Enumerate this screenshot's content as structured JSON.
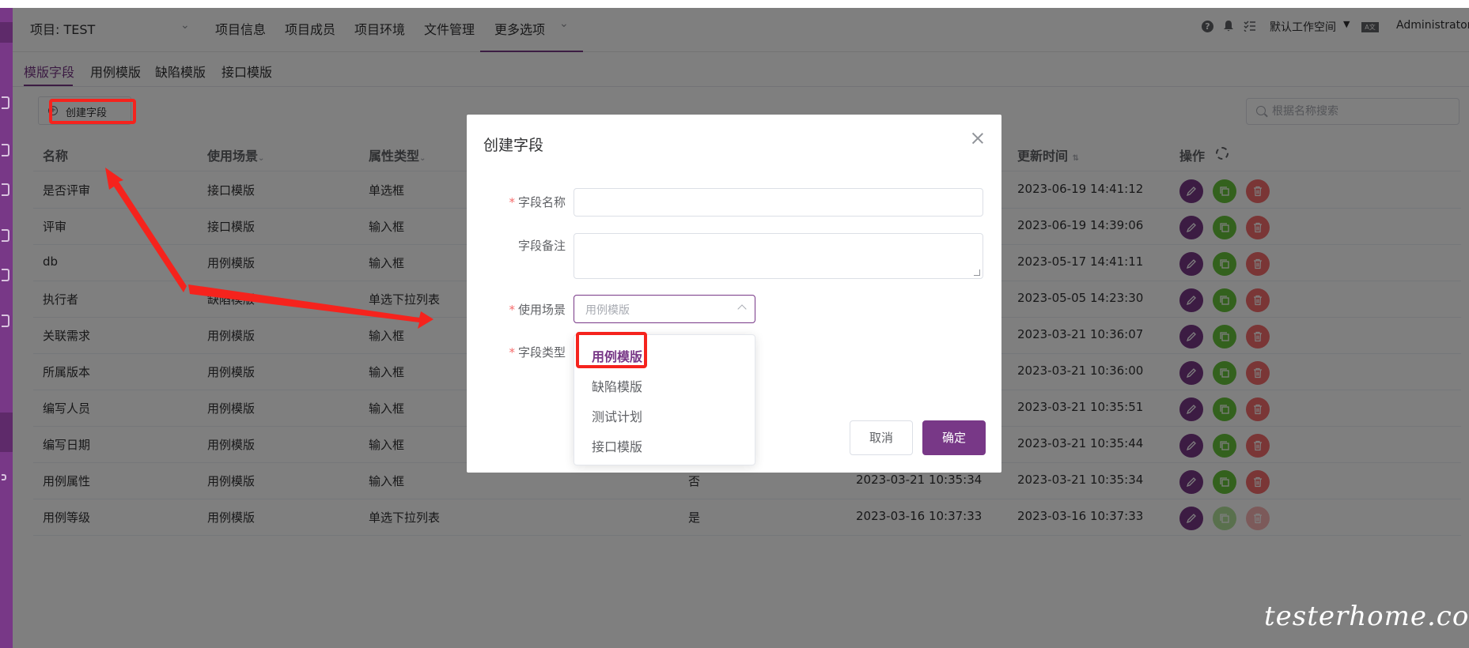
{
  "header": {
    "project_label": "项目: TEST",
    "nav": [
      "项目信息",
      "项目成员",
      "项目环境",
      "文件管理"
    ],
    "more_options": "更多选项",
    "workspace": "默认工作空间",
    "user": "Administrator"
  },
  "tabs": [
    "模版字段",
    "用例模版",
    "缺陷模版",
    "接口模版"
  ],
  "toolbar": {
    "create_label": "创建字段",
    "search_placeholder": "根据名称搜索"
  },
  "table": {
    "columns": [
      "名称",
      "使用场景",
      "属性类型",
      "更新时间",
      "操作"
    ],
    "rows": [
      {
        "name": "是否评审",
        "scene": "接口模版",
        "type": "单选框",
        "updated": "2023-06-19 14:41:12"
      },
      {
        "name": "评审",
        "scene": "接口模版",
        "type": "输入框",
        "updated": "2023-06-19 14:39:06"
      },
      {
        "name": "db",
        "scene": "用例模版",
        "type": "输入框",
        "updated": "2023-05-17 14:41:11"
      },
      {
        "name": "执行者",
        "scene": "缺陷模版",
        "type": "单选下拉列表",
        "updated": "2023-05-05 14:23:30"
      },
      {
        "name": "关联需求",
        "scene": "用例模版",
        "type": "输入框",
        "updated": "2023-03-21 10:36:07"
      },
      {
        "name": "所属版本",
        "scene": "用例模版",
        "type": "输入框",
        "updated": "2023-03-21 10:36:00"
      },
      {
        "name": "编写人员",
        "scene": "用例模版",
        "type": "输入框",
        "updated": "2023-03-21 10:35:51"
      },
      {
        "name": "编写日期",
        "scene": "用例模版",
        "type": "输入框",
        "updated": "2023-03-21 10:35:44"
      },
      {
        "name": "用例属性",
        "scene": "用例模版",
        "type": "输入框",
        "system": "否",
        "created": "2023-03-21 10:35:34",
        "updated": "2023-03-21 10:35:34"
      },
      {
        "name": "用例等级",
        "scene": "用例模版",
        "type": "单选下拉列表",
        "system": "是",
        "created": "2023-03-16 10:37:33",
        "updated": "2023-03-16 10:37:33"
      }
    ]
  },
  "dialog": {
    "title": "创建字段",
    "field_name_label": "字段名称",
    "field_remark_label": "字段备注",
    "scene_label": "使用场景",
    "scene_placeholder": "用例模版",
    "type_label": "字段类型",
    "scene_options": [
      "用例模版",
      "缺陷模版",
      "测试计划",
      "接口模版"
    ],
    "selected_option": "用例模版",
    "cancel_label": "取消",
    "ok_label": "确定"
  },
  "watermark": "testerhome.com",
  "colors": {
    "primary": "#783887",
    "success": "#67c23a",
    "danger": "#f56c6c",
    "annotation": "#f5231d"
  }
}
